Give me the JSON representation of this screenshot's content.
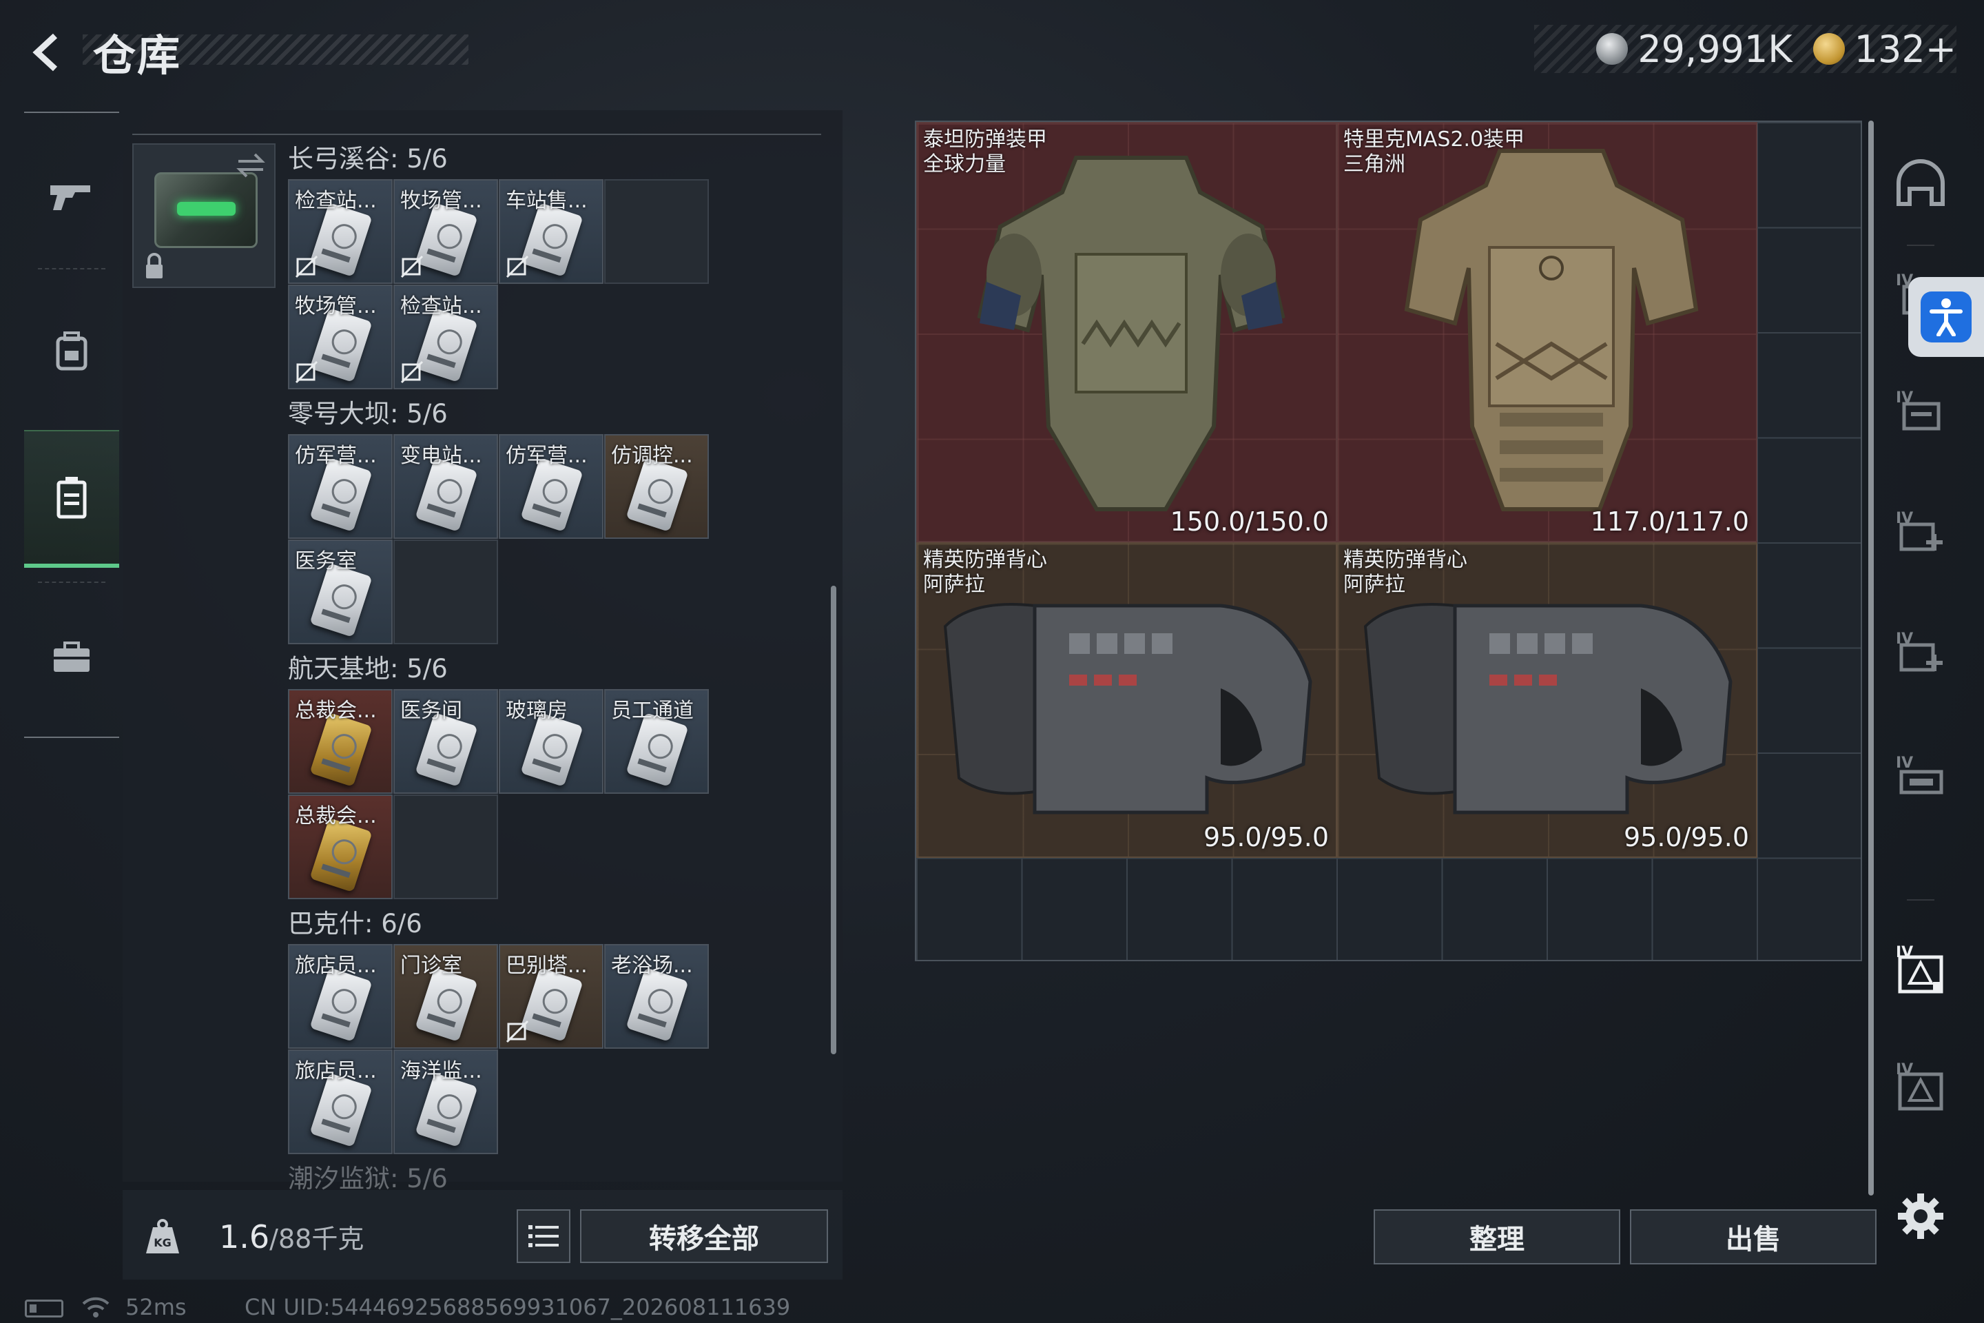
{
  "header": {
    "title": "仓库",
    "currency": [
      {
        "icon": "silver-coin-icon",
        "value": "29,991K"
      },
      {
        "icon": "gold-coin-icon",
        "value": "132+"
      }
    ]
  },
  "left_nav": [
    "weapon-icon",
    "backpack-icon",
    "storage-icon",
    "briefcase-icon"
  ],
  "groups": [
    {
      "title": "长弓溪谷: 5/6",
      "items": [
        {
          "label": "检查站...",
          "bg": "blue",
          "card": "silver",
          "no_link": true
        },
        {
          "label": "牧场管...",
          "bg": "blue",
          "card": "silver",
          "no_link": true
        },
        {
          "label": "车站售...",
          "bg": "blue",
          "card": "silver",
          "no_link": true
        },
        {
          "label": "牧场管...",
          "bg": "blue",
          "card": "silver",
          "no_link": true
        },
        {
          "label": "检查站...",
          "bg": "blue",
          "card": "silver",
          "no_link": true
        }
      ]
    },
    {
      "title": "零号大坝: 5/6",
      "items": [
        {
          "label": "仿军营...",
          "bg": "blue",
          "card": "silver",
          "no_link": false
        },
        {
          "label": "变电站...",
          "bg": "blue",
          "card": "silver",
          "no_link": false
        },
        {
          "label": "仿军营...",
          "bg": "blue",
          "card": "silver",
          "no_link": false
        },
        {
          "label": "仿调控...",
          "bg": "brown",
          "card": "silver",
          "no_link": false
        },
        {
          "label": "医务室",
          "bg": "blue",
          "card": "silver",
          "no_link": false
        }
      ]
    },
    {
      "title": "航天基地: 5/6",
      "items": [
        {
          "label": "总裁会...",
          "bg": "red",
          "card": "gold",
          "no_link": false
        },
        {
          "label": "医务间",
          "bg": "blue",
          "card": "silver",
          "no_link": false
        },
        {
          "label": "玻璃房",
          "bg": "blue",
          "card": "silver",
          "no_link": false
        },
        {
          "label": "员工通道",
          "bg": "blue",
          "card": "silver",
          "no_link": false
        },
        {
          "label": "总裁会...",
          "bg": "red",
          "card": "gold",
          "no_link": false
        }
      ]
    },
    {
      "title": "巴克什: 6/6",
      "items": [
        {
          "label": "旅店员...",
          "bg": "blue",
          "card": "silver",
          "no_link": false
        },
        {
          "label": "门诊室",
          "bg": "brown",
          "card": "silver",
          "no_link": false
        },
        {
          "label": "巴别塔...",
          "bg": "brown",
          "card": "silver",
          "no_link": true
        },
        {
          "label": "老浴场...",
          "bg": "blue",
          "card": "silver",
          "no_link": false
        },
        {
          "label": "旅店员...",
          "bg": "blue",
          "card": "silver",
          "no_link": false
        },
        {
          "label": "海洋监...",
          "bg": "blue",
          "card": "silver",
          "no_link": false
        }
      ]
    },
    {
      "title": "潮汐监狱: 5/6",
      "items": []
    }
  ],
  "footer": {
    "weight": "1.6",
    "capacity": "/88千克",
    "transfer_all": "转移全部"
  },
  "stash": {
    "items": [
      {
        "name1": "泰坦防弹装甲",
        "name2": "全球力量",
        "durability": "150.0/150.0",
        "bg": "red"
      },
      {
        "name1": "特里克MAS2.0装甲",
        "name2": "三角洲",
        "durability": "117.0/117.0",
        "bg": "red"
      },
      {
        "name1": "精英防弹背心",
        "name2": "阿萨拉",
        "durability": "95.0/95.0",
        "bg": "brown"
      },
      {
        "name1": "精英防弹背心",
        "name2": "阿萨拉",
        "durability": "95.0/95.0",
        "bg": "brown"
      }
    ],
    "sort_label": "整理",
    "sell_label": "出售"
  },
  "right_rail": [
    "helmet-icon",
    "armor-slot-icon",
    "chest-rig-icon",
    "medkit-slot-icon",
    "medkit-slot-icon",
    "backpack-slot-icon",
    "armor-case-icon",
    "armor-case-icon"
  ],
  "status": {
    "ping": "52ms",
    "uid": "CN UID:5444692568856993106​7_202608111639"
  },
  "colors": {
    "accent_green": "#5ec98a",
    "item_red": "#4a2629",
    "item_brown": "#3c3128",
    "item_blue": "#33404d"
  }
}
